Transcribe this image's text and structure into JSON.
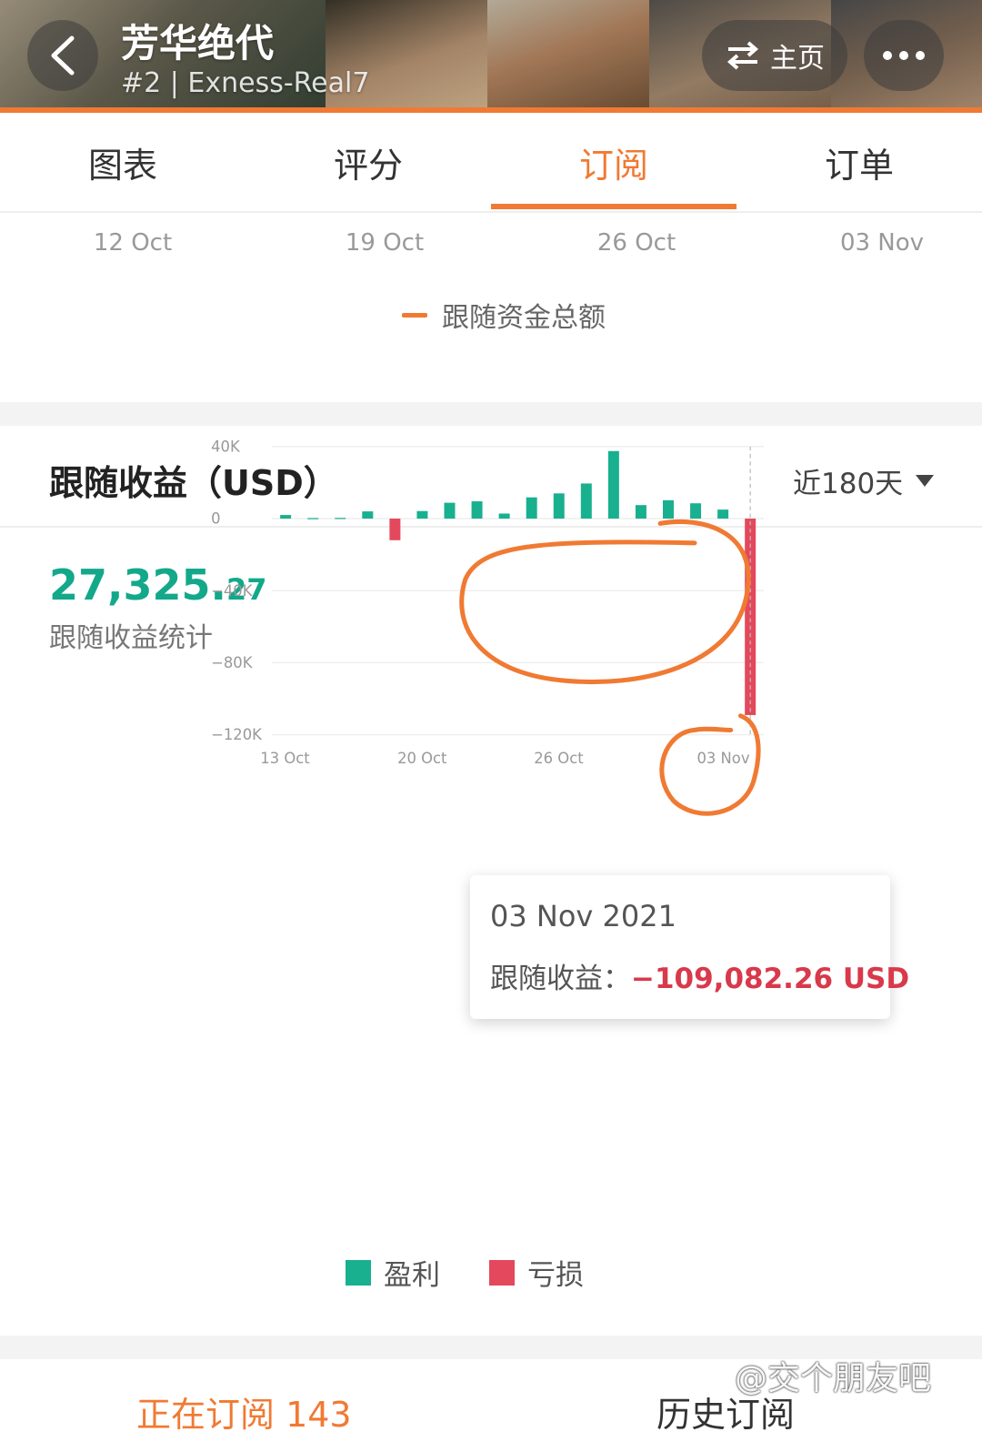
{
  "header": {
    "title": "芳华绝代",
    "subtitle": "#2 | Exness-Real7",
    "home_label": "主页"
  },
  "tabs": [
    {
      "label": "图表",
      "active": false
    },
    {
      "label": "评分",
      "active": false
    },
    {
      "label": "订阅",
      "active": true
    },
    {
      "label": "订单",
      "active": false
    }
  ],
  "fund_chart": {
    "x_ticks": [
      "12 Oct",
      "19 Oct",
      "26 Oct",
      "03 Nov"
    ],
    "legend": "跟随资金总额"
  },
  "profit_section": {
    "title": "跟随收益（USD）",
    "period": "近180天",
    "total_int": "27,325.",
    "total_dec": "27",
    "total_label": "跟随收益统计"
  },
  "tooltip": {
    "date": "03 Nov 2021",
    "label": "跟随收益：",
    "value": "−109,082.26 USD"
  },
  "chart_data": {
    "type": "bar",
    "title": "跟随收益（USD）",
    "y_ticks": [
      "40K",
      "0",
      "−40K",
      "−80K",
      "−120K"
    ],
    "ylim": [
      -120000,
      40000
    ],
    "x_tick_labels": [
      "13 Oct",
      "20 Oct",
      "26 Oct",
      "03 Nov"
    ],
    "values": [
      2000,
      300,
      400,
      4000,
      -12000,
      4200,
      8800,
      9600,
      2800,
      11800,
      14000,
      19500,
      37500,
      7500,
      10200,
      8500,
      5000,
      -109082.26
    ],
    "legend": [
      {
        "name": "盈利",
        "color": "#19b08f"
      },
      {
        "name": "亏损",
        "color": "#e4485c"
      }
    ]
  },
  "bottom_tabs": {
    "active_label": "正在订阅 143",
    "history_label": "历史订阅"
  },
  "watermark": "@交个朋友吧",
  "colors": {
    "accent": "#f07a33",
    "profit": "#19b08f",
    "loss": "#e4485c",
    "total": "#13a88a"
  }
}
